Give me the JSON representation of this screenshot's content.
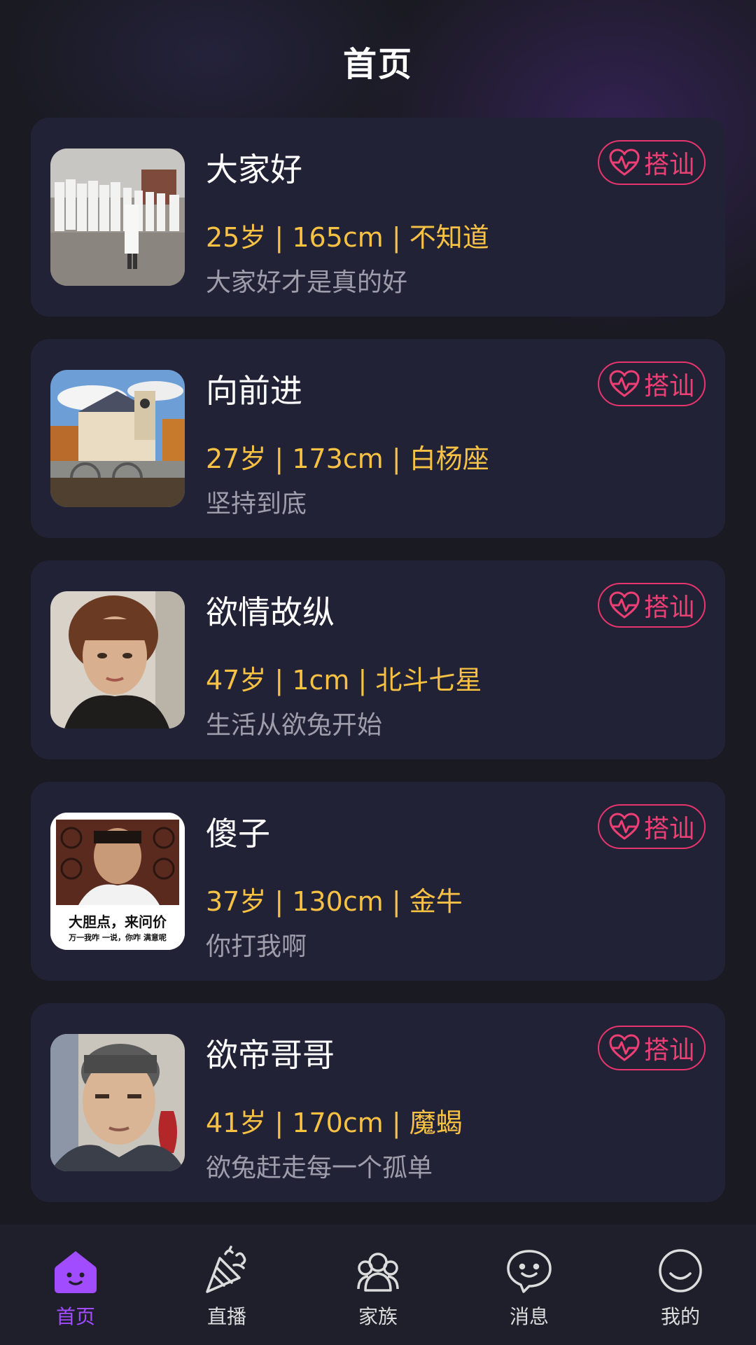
{
  "header": {
    "title": "首页"
  },
  "pickup_label": "搭讪",
  "cards": [
    {
      "name": "大家好",
      "meta": "25岁 | 165cm | 不知道",
      "bio": "大家好才是真的好"
    },
    {
      "name": "向前进",
      "meta": "27岁 | 173cm | 白杨座",
      "bio": "坚持到底"
    },
    {
      "name": "欲情故纵",
      "meta": "47岁 | 1cm | 北斗七星",
      "bio": "生活从欲兔开始"
    },
    {
      "name": "傻子",
      "meta": "37岁 | 130cm | 金牛",
      "bio": "你打我啊",
      "avatar_caption_1": "大胆点，来问价",
      "avatar_caption_2": "万一我咋 一说，你咋 满意呢"
    },
    {
      "name": "欲帝哥哥",
      "meta": "41岁 | 170cm | 魔蝎",
      "bio": "欲兔赶走每一个孤单"
    }
  ],
  "tabbar": {
    "tabs": [
      {
        "label": "首页",
        "icon": "home-icon",
        "active": true
      },
      {
        "label": "直播",
        "icon": "party-popper-icon",
        "active": false
      },
      {
        "label": "家族",
        "icon": "family-group-icon",
        "active": false
      },
      {
        "label": "消息",
        "icon": "chat-bubble-icon",
        "active": false
      },
      {
        "label": "我的",
        "icon": "smiley-profile-icon",
        "active": false
      }
    ]
  },
  "colors": {
    "background": "#1a1a22",
    "card": "#222236",
    "meta_yellow": "#f7c144",
    "accent_pink": "#e8356d",
    "tab_active_purple": "#a24cff"
  }
}
